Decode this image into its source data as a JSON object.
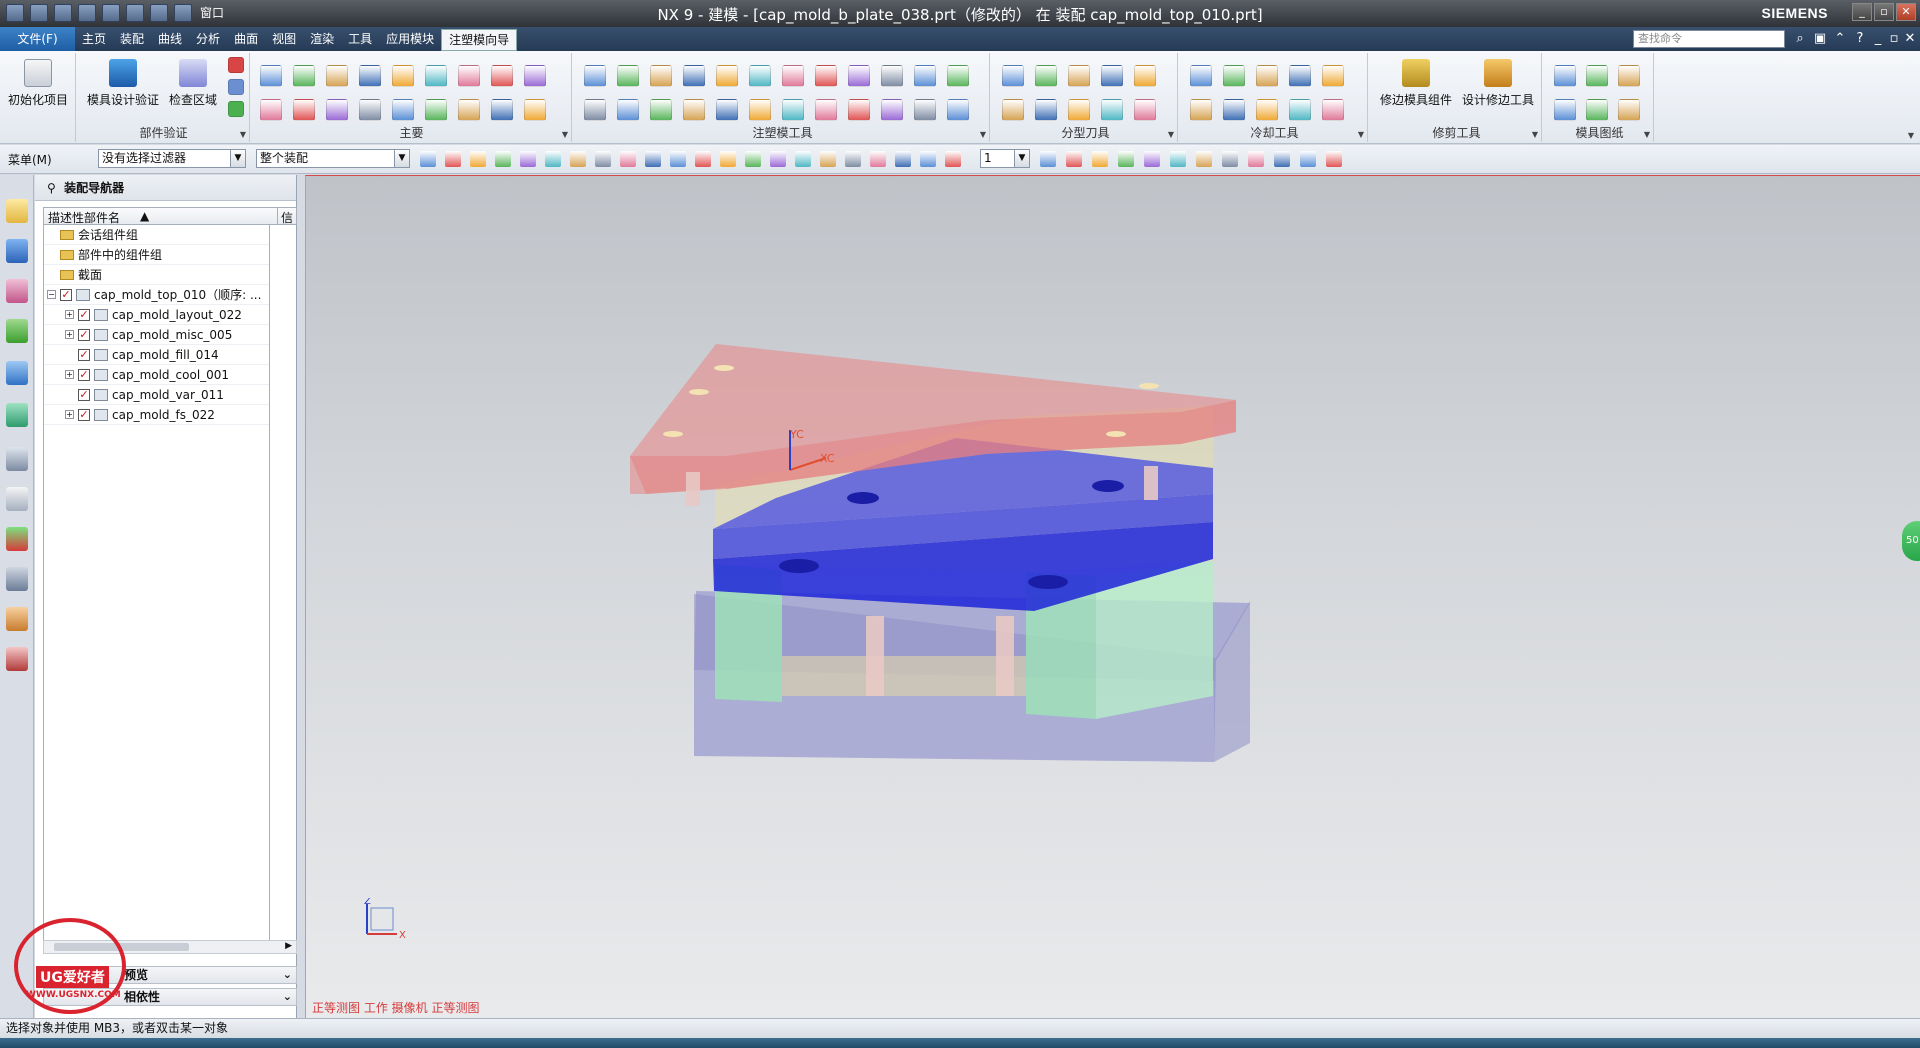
{
  "window": {
    "title": "NX 9 - 建模 - [cap_mold_b_plate_038.prt（修改的） 在 装配 cap_mold_top_010.prt]",
    "brand": "SIEMENS",
    "qat_window_label": "窗口"
  },
  "menubar": {
    "file_label": "文件(F)",
    "tabs": [
      "主页",
      "装配",
      "曲线",
      "分析",
      "曲面",
      "视图",
      "渲染",
      "工具",
      "应用模块",
      "注塑模向导"
    ],
    "active_tab": "注塑模向导",
    "search_placeholder": "查找命令"
  },
  "ribbon": {
    "groups": [
      {
        "label": "",
        "buttons": [
          "初始化项目"
        ]
      },
      {
        "label": "部件验证",
        "buttons": [
          "模具设计验证",
          "检查区域"
        ]
      },
      {
        "label": "主要",
        "buttons": []
      },
      {
        "label": "注塑模工具",
        "buttons": []
      },
      {
        "label": "分型刀具",
        "buttons": []
      },
      {
        "label": "冷却工具",
        "buttons": []
      },
      {
        "label": "修剪工具",
        "buttons": [
          "修边模具组件",
          "设计修边工具"
        ]
      },
      {
        "label": "模具图纸",
        "buttons": []
      }
    ]
  },
  "selbar": {
    "menu_label": "菜单(M)",
    "filter_value": "没有选择过滤器",
    "scope_value": "整个装配",
    "layer_value": "1"
  },
  "navigator": {
    "title": "装配导航器",
    "col_name": "描述性部件名",
    "col_info": "信",
    "rows": [
      {
        "label": "会话组件组",
        "type": "folder",
        "indent": 0
      },
      {
        "label": "部件中的组件组",
        "type": "folder",
        "indent": 0
      },
      {
        "label": "截面",
        "type": "folder",
        "indent": 0
      },
      {
        "label": "cap_mold_top_010（顺序: ...",
        "type": "root",
        "indent": 0
      },
      {
        "label": "cap_mold_layout_022",
        "type": "asm",
        "indent": 1
      },
      {
        "label": "cap_mold_misc_005",
        "type": "asm",
        "indent": 1
      },
      {
        "label": "cap_mold_fill_014",
        "type": "part",
        "indent": 1
      },
      {
        "label": "cap_mold_cool_001",
        "type": "asm",
        "indent": 1
      },
      {
        "label": "cap_mold_var_011",
        "type": "part",
        "indent": 1
      },
      {
        "label": "cap_mold_fs_022",
        "type": "asm",
        "indent": 1
      }
    ],
    "preview_label": "预览",
    "dependency_label": "相依性"
  },
  "viewport": {
    "view_label": "正等测图 工作 摄像机 正等测图",
    "triad_x": "X",
    "triad_z": "Z",
    "wcs_xc": "XC",
    "wcs_yc": "YC",
    "side_tab": "50"
  },
  "status": {
    "message": "选择对象并使用 MB3，或者双击某一对象"
  },
  "watermark": {
    "text": "UG爱好者",
    "url": "WWW.UGSNX.COM"
  },
  "colors": {
    "top_plate": "#e88a8a",
    "b_plate": "#1f25d9",
    "spacer": "#9fe0b8",
    "clamp": "#9b9ccf",
    "accent": "#2a66b4"
  }
}
